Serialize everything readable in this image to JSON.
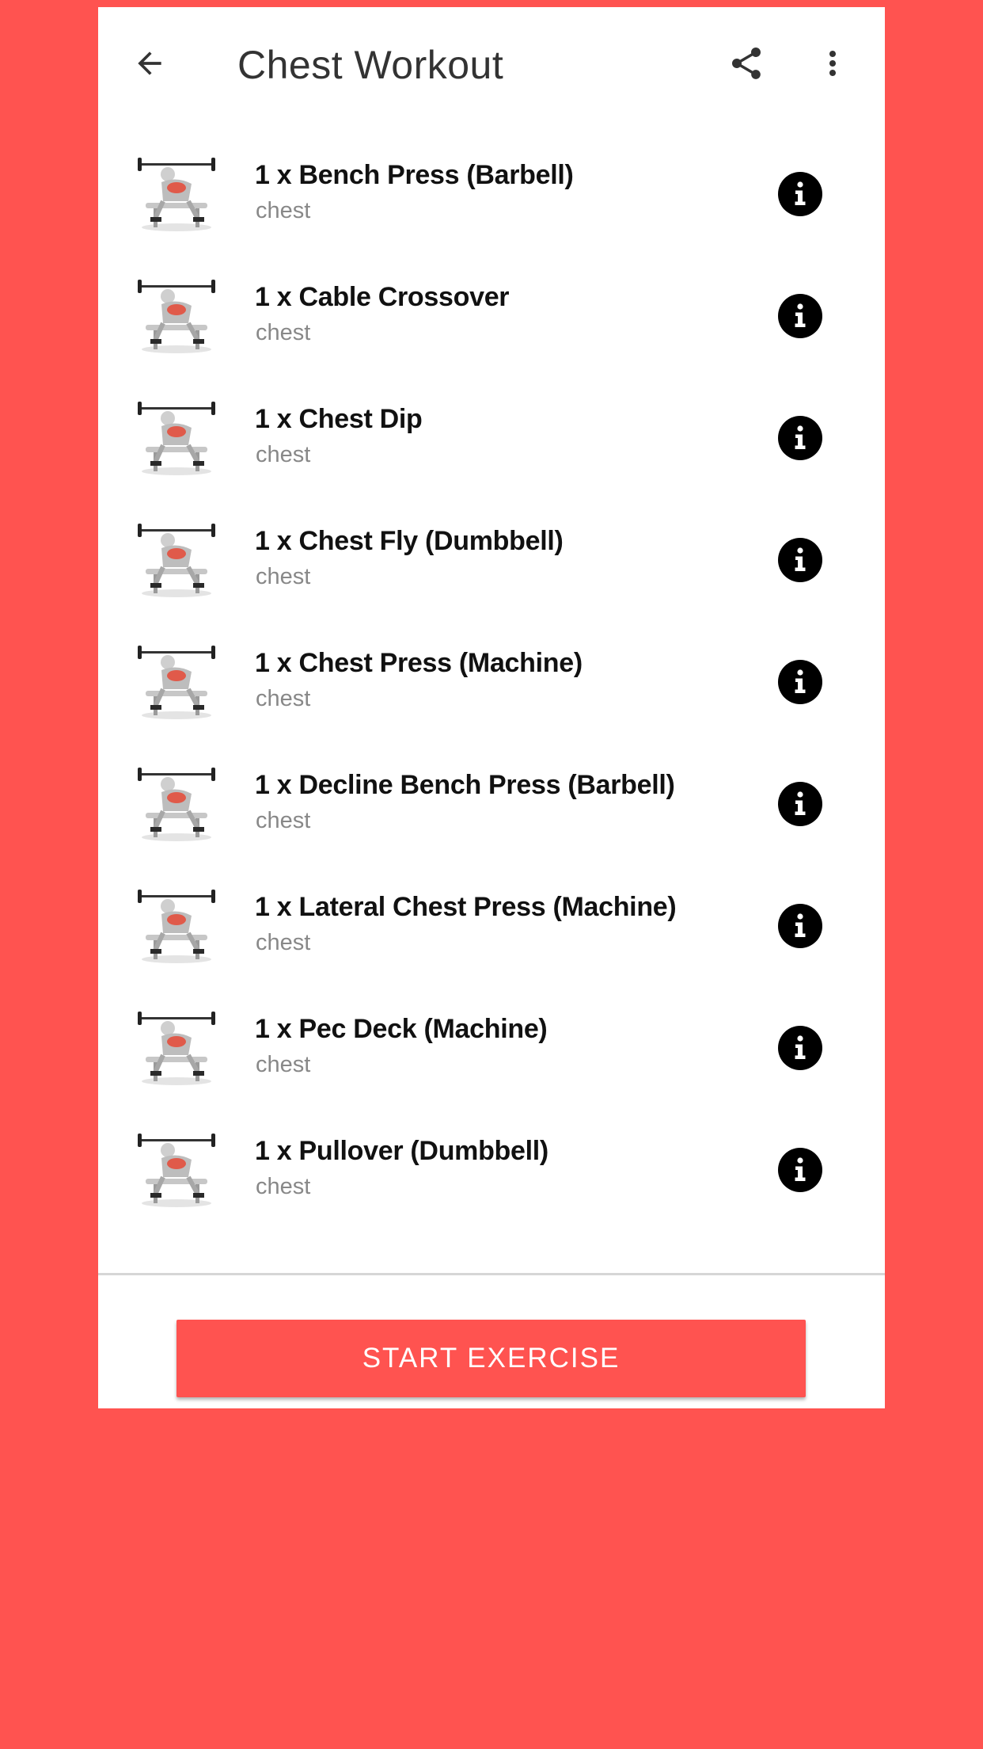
{
  "colors": {
    "accent": "#ff5350",
    "title_text": "#333333",
    "subtitle_text": "#888888",
    "info_icon": "#000000"
  },
  "toolbar": {
    "back_icon": "arrow-back-icon",
    "title": "Chest Workout",
    "share_icon": "share-icon",
    "more_icon": "more-vertical-icon"
  },
  "exercises": [
    {
      "name": "1 x Bench Press (Barbell)",
      "muscle": "chest",
      "thumb": "bench-press-barbell-thumbnail"
    },
    {
      "name": "1 x Cable Crossover",
      "muscle": "chest",
      "thumb": "cable-crossover-thumbnail"
    },
    {
      "name": "1 x Chest Dip",
      "muscle": "chest",
      "thumb": "chest-dip-thumbnail"
    },
    {
      "name": "1 x Chest Fly (Dumbbell)",
      "muscle": "chest",
      "thumb": "chest-fly-dumbbell-thumbnail"
    },
    {
      "name": "1 x Chest Press (Machine)",
      "muscle": "chest",
      "thumb": "chest-press-machine-thumbnail"
    },
    {
      "name": "1 x Decline Bench Press (Barbell)",
      "muscle": "chest",
      "thumb": "decline-bench-press-thumbnail"
    },
    {
      "name": "1 x Lateral Chest Press (Machine)",
      "muscle": "chest",
      "thumb": "lateral-chest-press-thumbnail"
    },
    {
      "name": "1 x Pec Deck (Machine)",
      "muscle": "chest",
      "thumb": "pec-deck-thumbnail"
    },
    {
      "name": "1 x Pullover (Dumbbell)",
      "muscle": "chest",
      "thumb": "pullover-dumbbell-thumbnail"
    }
  ],
  "footer": {
    "start_label": "START EXERCISE"
  }
}
